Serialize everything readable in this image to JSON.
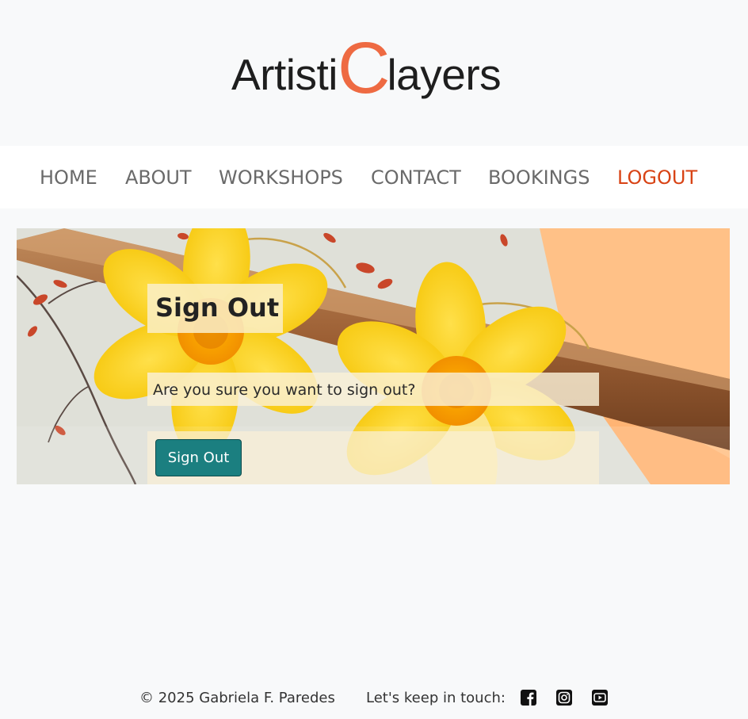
{
  "logo": {
    "part1": "Artisti",
    "part2": "C",
    "part3": "layers",
    "accent_color": "#ee6a42"
  },
  "nav": {
    "items": [
      {
        "label": "HOME"
      },
      {
        "label": "ABOUT"
      },
      {
        "label": "WORKSHOPS"
      },
      {
        "label": "CONTACT"
      },
      {
        "label": "BOOKINGS"
      },
      {
        "label": "LOGOUT",
        "active": true
      }
    ],
    "active_color": "#d84315"
  },
  "main": {
    "title": "Sign Out",
    "message": "Are you sure you want to sign out?",
    "button_label": "Sign Out",
    "button_color": "#1b7f80"
  },
  "footer": {
    "copyright": "© 2025 Gabriela F. Paredes",
    "touch_label": "Let's keep in touch:",
    "social_icons": [
      "facebook-icon",
      "instagram-icon",
      "youtube-icon"
    ]
  }
}
